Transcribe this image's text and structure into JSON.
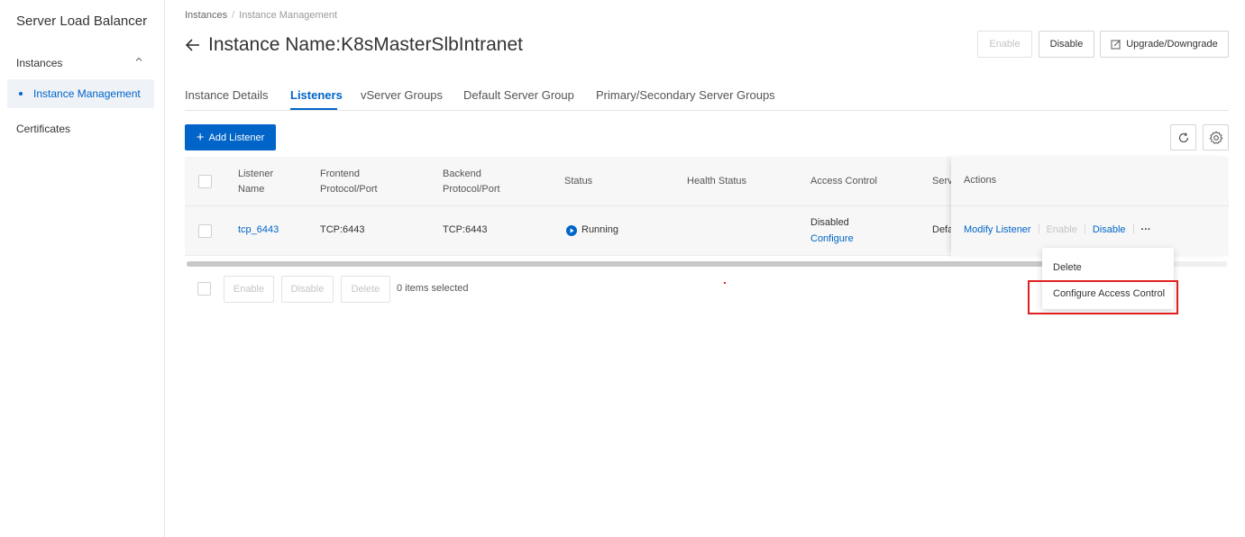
{
  "sidebar": {
    "title": "Server Load Balancer",
    "group_label": "Instances",
    "active_item": "Instance Management",
    "certificates": "Certificates"
  },
  "breadcrumb": {
    "root": "Instances",
    "separator": "/",
    "current": "Instance Management"
  },
  "header": {
    "back_arrow": "←",
    "title": "Instance Name:K8sMasterSlbIntranet",
    "buttons": {
      "enable": "Enable",
      "disable": "Disable",
      "upgrade": "Upgrade/Downgrade"
    }
  },
  "tabs": [
    {
      "label": "Instance Details",
      "active": false
    },
    {
      "label": "Listeners",
      "active": true
    },
    {
      "label": "vServer Groups",
      "active": false
    },
    {
      "label": "Default Server Group",
      "active": false
    },
    {
      "label": "Primary/Secondary Server Groups",
      "active": false
    }
  ],
  "toolbar": {
    "add_listener": "Add Listener",
    "add_icon": "+"
  },
  "table": {
    "columns": {
      "listener_name_1": "Listener",
      "listener_name_2": "Name",
      "frontend_1": "Frontend",
      "frontend_2": "Protocol/Port",
      "backend_1": "Backend",
      "backend_2": "Protocol/Port",
      "status": "Status",
      "health_status": "Health Status",
      "access_control": "Access Control",
      "server_group_truncated": "Serv",
      "actions": "Actions"
    },
    "rows": [
      {
        "name": "tcp_6443",
        "frontend": "TCP:6443",
        "backend": "TCP:6443",
        "status": "Running",
        "health_status": "",
        "access_control_state": "Disabled",
        "access_control_link": "Configure",
        "server_group_truncated": "Defa",
        "actions": {
          "modify": "Modify Listener",
          "enable": "Enable",
          "disable": "Disable",
          "more": "···"
        }
      }
    ]
  },
  "batch": {
    "enable": "Enable",
    "disable": "Disable",
    "delete": "Delete",
    "selected": "0 items selected"
  },
  "dropdown": {
    "items": [
      "Delete",
      "Configure Access Control"
    ]
  },
  "colors": {
    "accent": "#0064c8",
    "highlight": "#e02020"
  }
}
